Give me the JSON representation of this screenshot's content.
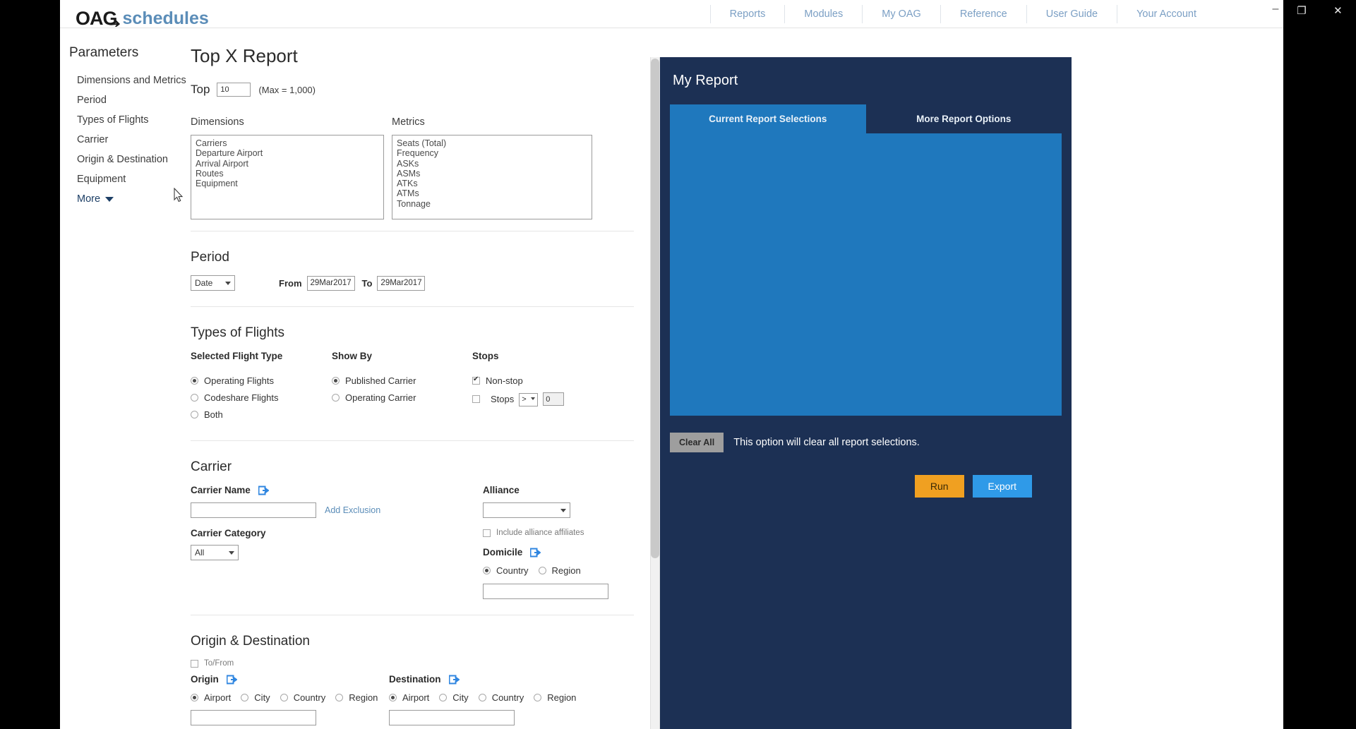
{
  "window": {
    "minimize": "–",
    "restore": "❐",
    "close": "✕"
  },
  "brand": {
    "oag": "OAG",
    "schedules": "schedules",
    "plane_icon": "airplane-icon"
  },
  "topnav": {
    "links": [
      {
        "label": "Reports"
      },
      {
        "label": "Modules"
      },
      {
        "label": "My OAG"
      },
      {
        "label": "Reference"
      },
      {
        "label": "User Guide"
      },
      {
        "label": "Your Account"
      }
    ]
  },
  "sidebar": {
    "title": "Parameters",
    "items": [
      {
        "label": "Dimensions and Metrics"
      },
      {
        "label": "Period"
      },
      {
        "label": "Types of Flights"
      },
      {
        "label": "Carrier"
      },
      {
        "label": "Origin & Destination"
      },
      {
        "label": "Equipment"
      },
      {
        "label": "More"
      }
    ]
  },
  "main": {
    "page_title": "Top X Report",
    "help_glyph": "?",
    "top": {
      "label": "Top",
      "value": "10",
      "max_note": "(Max = 1,000)"
    },
    "dimensions": {
      "label": "Dimensions",
      "options": [
        "Carriers",
        "Departure Airport",
        "Arrival Airport",
        "Routes",
        "Equipment"
      ]
    },
    "metrics": {
      "label": "Metrics",
      "options": [
        "Seats (Total)",
        "Frequency",
        "ASKs",
        "ASMs",
        "ATKs",
        "ATMs",
        "Tonnage"
      ]
    },
    "period": {
      "title": "Period",
      "mode": "Date",
      "from_label": "From",
      "from_value": "29Mar2017",
      "to_label": "To",
      "to_value": "29Mar2017"
    },
    "types_of_flights": {
      "title": "Types of Flights",
      "flight_type": {
        "heading": "Selected Flight Type",
        "options": [
          {
            "label": "Operating Flights",
            "selected": true
          },
          {
            "label": "Codeshare Flights",
            "selected": false
          },
          {
            "label": "Both",
            "selected": false
          }
        ]
      },
      "show_by": {
        "heading": "Show By",
        "options": [
          {
            "label": "Published Carrier",
            "selected": true
          },
          {
            "label": "Operating Carrier",
            "selected": false
          }
        ]
      },
      "stops": {
        "heading": "Stops",
        "nonstop": {
          "label": "Non-stop",
          "checked": true
        },
        "stops": {
          "label": "Stops",
          "checked": false,
          "operator": ">",
          "value": "0"
        }
      }
    },
    "carrier": {
      "title": "Carrier",
      "name_label": "Carrier Name",
      "name_value": "",
      "name_icon": "external-link-icon",
      "add_exclusion": "Add Exclusion",
      "category_label": "Carrier Category",
      "category_value": "All",
      "alliance_label": "Alliance",
      "alliance_value": "",
      "include_affiliates": {
        "label": "Include alliance affiliates",
        "checked": false
      },
      "domicile_label": "Domicile",
      "domicile_icon": "external-link-icon",
      "domicile_options": [
        {
          "label": "Country",
          "selected": true
        },
        {
          "label": "Region",
          "selected": false
        }
      ],
      "domicile_value": ""
    },
    "origin_destination": {
      "title": "Origin & Destination",
      "to_from": {
        "label": "To/From",
        "checked": false
      },
      "origin": {
        "label": "Origin",
        "icon": "external-link-icon",
        "options": [
          {
            "label": "Airport",
            "selected": true
          },
          {
            "label": "City",
            "selected": false
          },
          {
            "label": "Country",
            "selected": false
          },
          {
            "label": "Region",
            "selected": false
          }
        ],
        "value": ""
      },
      "destination": {
        "label": "Destination",
        "icon": "external-link-icon",
        "options": [
          {
            "label": "Airport",
            "selected": true
          },
          {
            "label": "City",
            "selected": false
          },
          {
            "label": "Country",
            "selected": false
          },
          {
            "label": "Region",
            "selected": false
          }
        ],
        "value": ""
      }
    }
  },
  "report_panel": {
    "title": "My Report",
    "tabs": [
      {
        "label": "Current Report Selections",
        "active": true
      },
      {
        "label": "More Report Options",
        "active": false
      }
    ],
    "clear_all_label": "Clear All",
    "clear_note": "This option will clear all report selections.",
    "run_label": "Run",
    "export_label": "Export"
  },
  "colors": {
    "panel_bg": "#1c3054",
    "panel_accent": "#1f78bd",
    "run": "#f0a021",
    "export": "#2f9ae8",
    "brand_blue": "#5b8db8",
    "link": "#5b8db8"
  }
}
